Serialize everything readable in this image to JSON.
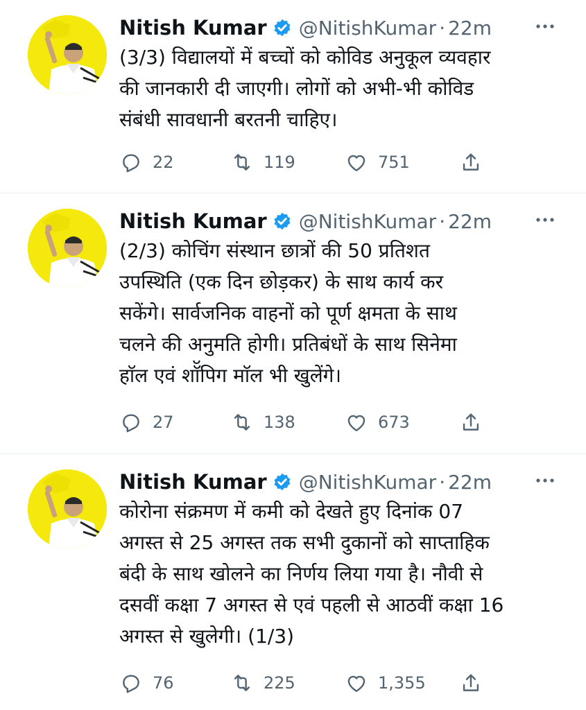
{
  "tweets": [
    {
      "author": "Nitish Kumar",
      "handle": "@NitishKumar",
      "time": "22m",
      "separator": "·",
      "text_lines": [
        "(3/3) विद्यालयों में बच्चों को कोविड अनुकूल व्यवहार",
        "की जानकारी दी जाएगी। लोगों को अभी-भी कोविड",
        "संबंधी सावधानी बरतनी चाहिए।"
      ],
      "replies": "22",
      "retweets": "119",
      "likes": "751"
    },
    {
      "author": "Nitish Kumar",
      "handle": "@NitishKumar",
      "time": "22m",
      "separator": "·",
      "text_lines": [
        "(2/3) कोचिंग संस्थान छात्रों की 50 प्रतिशत",
        "उपस्थिति (एक दिन छोड़कर) के साथ कार्य कर",
        "सकेंगे। सार्वजनिक वाहनों को पूर्ण क्षमता के साथ",
        "चलने की अनुमति होगी। प्रतिबंधों के साथ सिनेमा",
        "हाॅल एवं शाॅॅपिग माॅल भी खुलेंगे।"
      ],
      "replies": "27",
      "retweets": "138",
      "likes": "673"
    },
    {
      "author": "Nitish Kumar",
      "handle": "@NitishKumar",
      "time": "22m",
      "separator": "·",
      "text_lines": [
        "कोरोना संक्रमण में कमी को देखते हुए दिनांक 07",
        "अगस्त से 25 अगस्त तक सभी दुकानों को साप्ताहिक",
        "बंदी के साथ खोलने का निर्णय लिया गया है।  नौवी से",
        "दसवीं कक्षा 7 अगस्त से एवं पहली से आठवीं कक्षा 16",
        "अगस्त से खुलेगी। (1/3)"
      ],
      "replies": "76",
      "retweets": "225",
      "likes": "1,355"
    }
  ],
  "icons": {
    "verified": "verified-badge-icon",
    "more": "more-icon",
    "reply": "reply-icon",
    "retweet": "retweet-icon",
    "like": "like-icon",
    "share": "share-icon"
  },
  "colors": {
    "text": "#0f1419",
    "secondary": "#536471",
    "verified": "#1d9bf0",
    "divider": "#e6ecf0",
    "avatar_bg": "#f4e80c"
  }
}
